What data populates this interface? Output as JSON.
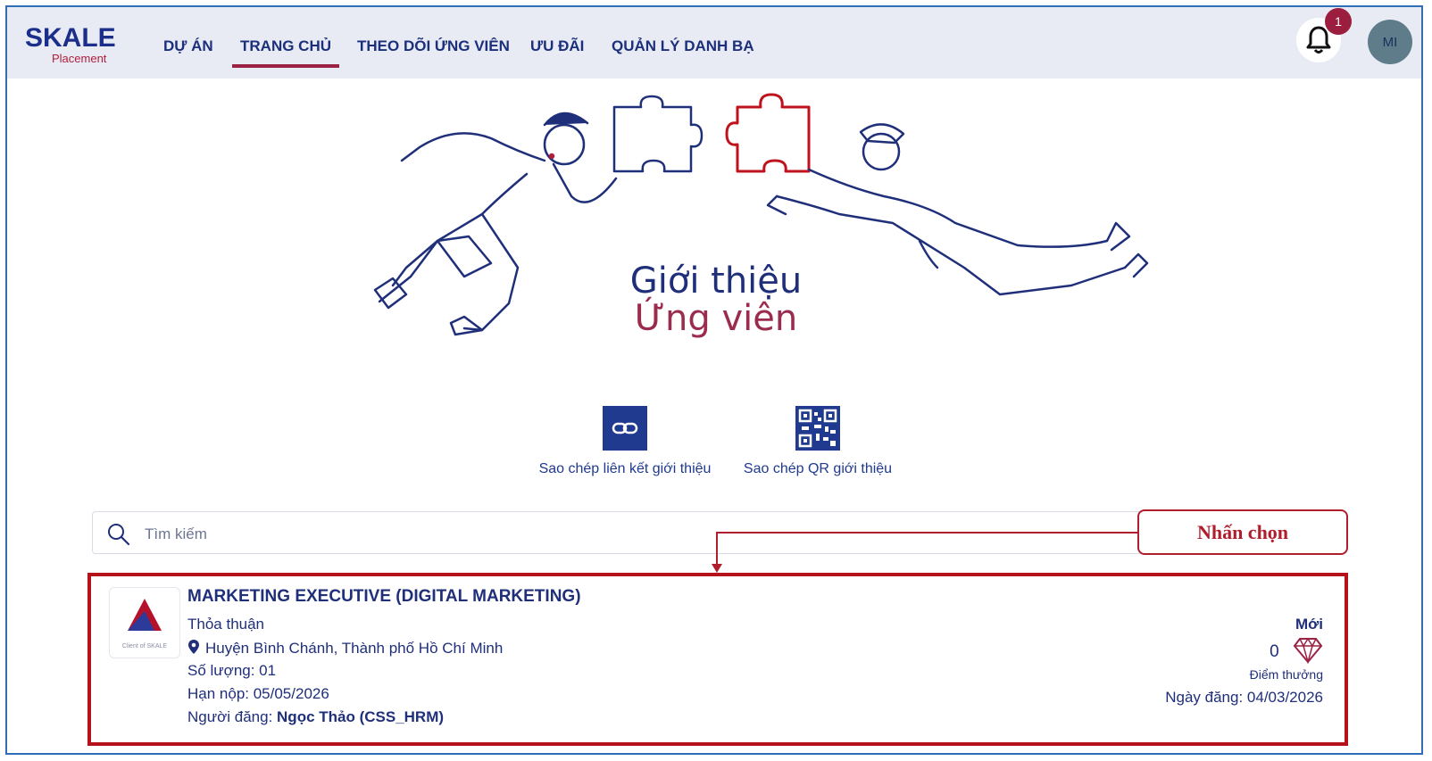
{
  "brand": {
    "name": "SKALE",
    "sub": "Placement"
  },
  "nav": {
    "items": [
      {
        "label": "DỰ ÁN"
      },
      {
        "label": "TRANG CHỦ"
      },
      {
        "label": "THEO DÕI ỨNG VIÊN"
      },
      {
        "label": "ƯU ĐÃI"
      },
      {
        "label": "QUẢN LÝ DANH BẠ"
      }
    ],
    "active": "TRANG CHỦ"
  },
  "header": {
    "notification_count": "1",
    "avatar_initials": "MI"
  },
  "hero": {
    "title_line1": "Giới thiệu",
    "title_line2": "Ứng viên"
  },
  "actions": {
    "copy_link": "Sao chép liên kết giới thiệu",
    "copy_qr": "Sao chép QR giới thiệu"
  },
  "search": {
    "placeholder": "Tìm kiếm",
    "value": ""
  },
  "annotation": {
    "callout": "Nhấn chọn"
  },
  "job": {
    "logo_caption": "Client of SKALE",
    "title": "MARKETING EXECUTIVE (DIGITAL MARKETING)",
    "salary": "Thỏa thuận",
    "location": "Huyện Bình Chánh, Thành phố Hồ Chí Minh",
    "quantity": "Số lượng: 01",
    "deadline": "Hạn nộp: 05/05/2026",
    "poster_label": "Người đăng: ",
    "poster_name": "Ngọc Thảo (CSS_HRM)",
    "status": "Mới",
    "points": "0",
    "points_label": "Điểm thưởng",
    "posted_date": "Ngày đăng: 04/03/2026"
  },
  "colors": {
    "navy": "#1f2f7a",
    "accent": "#9b2244",
    "annotation_red": "#b5121b",
    "tile": "#1f3a8e"
  }
}
